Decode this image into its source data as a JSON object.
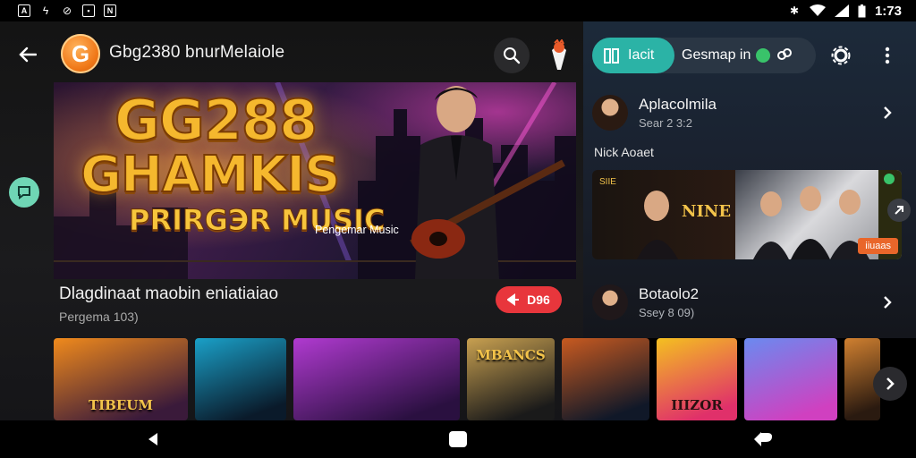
{
  "status_bar": {
    "time": "1:73",
    "left_icons": [
      "notification-icon",
      "charging-icon",
      "sync-icon",
      "save-icon",
      "nfc-icon"
    ],
    "right_icons": [
      "bluetooth-icon",
      "wifi-icon",
      "signal-icon",
      "battery-icon"
    ]
  },
  "header": {
    "logo_letter": "G",
    "title": "Gbg2380 bnurMelaiole"
  },
  "hero": {
    "line1": "GG288",
    "line2": "GHAMKIS",
    "line3": "PRIRGЭR MUSIC",
    "caption": "Pengemar Music"
  },
  "now_playing": {
    "title": "Dlagdinaat maobin eniatiaiao",
    "subtitle": "Pergema 103)",
    "chip_label": "D96"
  },
  "right_panel": {
    "tab_active": "Iacit",
    "tab_other": "Gesmap in",
    "artists": [
      {
        "name": "Aplacolmila",
        "meta": "Sear 2 3:2"
      },
      {
        "name": "Botaolo2",
        "meta": "Ssey 8 09)"
      }
    ],
    "section_label": "Nick Aoaet",
    "promo_left_text": "SIIE",
    "promo_mid_text": "NINE TEDAK",
    "promo_badge": "iiuaas"
  },
  "carousel": [
    {
      "label": "TIBEUM",
      "colors": [
        "#f08a1c",
        "#3a1a3a"
      ]
    },
    {
      "label": "",
      "colors": [
        "#1aa0c8",
        "#0a1a2a"
      ]
    },
    {
      "label": "",
      "colors": [
        "#b03ad0",
        "#2a1040"
      ]
    },
    {
      "label": "MBANCS",
      "colors": [
        "#c8a050",
        "#1a1a1a"
      ]
    },
    {
      "label": "",
      "colors": [
        "#c85a20",
        "#101828"
      ]
    },
    {
      "label": "IIIZOR",
      "colors": [
        "#f4c020",
        "#e0306a"
      ]
    },
    {
      "label": "",
      "colors": [
        "#6a8af0",
        "#d040c0"
      ]
    },
    {
      "label": "",
      "colors": [
        "#d08030",
        "#2a1a10"
      ]
    }
  ],
  "colors": {
    "accent_teal": "#2bb3a6",
    "play_red": "#e8363c",
    "gold": "#f5b82e"
  }
}
